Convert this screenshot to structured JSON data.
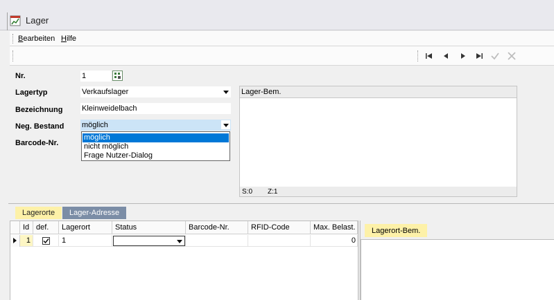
{
  "window": {
    "title": "Lager"
  },
  "menu": [
    {
      "label": "Bearbeiten",
      "underline": "B",
      "rest": "earbeiten"
    },
    {
      "label": "Hilfe",
      "underline": "H",
      "rest": "ilfe"
    }
  ],
  "form": {
    "nr_label": "Nr.",
    "nr_value": "1",
    "lagertyp_label": "Lagertyp",
    "lagertyp_value": "Verkaufslager",
    "bezeichnung_label": "Bezeichnung",
    "bezeichnung_value": "Kleinweidelbach",
    "neg_bestand_label": "Neg. Bestand",
    "neg_bestand_value": "möglich",
    "barcode_label": "Barcode-Nr.",
    "dropdown_options": [
      "möglich",
      "nicht möglich",
      "Frage Nutzer-Dialog"
    ]
  },
  "memo": {
    "header": "Lager-Bem.",
    "status_s": "S:0",
    "status_z": "Z:1"
  },
  "tabs": [
    "Lagerorte",
    "Lager-Adresse"
  ],
  "grid": {
    "columns": [
      "Id",
      "def.",
      "Lagerort",
      "Status",
      "Barcode-Nr.",
      "RFID-Code",
      "Max. Belast. ["
    ],
    "row": {
      "id": "1",
      "def": true,
      "lagerort": "1",
      "status": "",
      "barcode": "",
      "rfid": "",
      "max_belast": "0"
    }
  },
  "bem_tab": "Lagerort-Bem.",
  "colors": {
    "tab_active": "#fdf1a8",
    "tab_inactive": "#7b8da6",
    "selection": "#0078d7",
    "highlight_field": "#cce4f7"
  }
}
